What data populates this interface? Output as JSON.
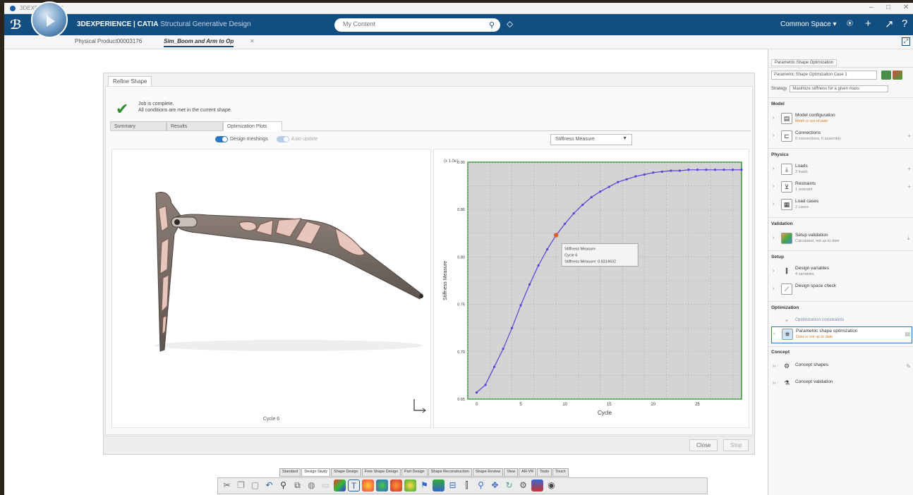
{
  "window": {
    "title": "3DEXPERIENCE",
    "min": "–",
    "max": "□",
    "close": "✕"
  },
  "topbar": {
    "brand_bold": "3DEXPERIENCE | CATIA",
    "brand_sub": "Structural Generative Design",
    "search_placeholder": "My Content",
    "space": "Common Space ▾"
  },
  "tabs": {
    "first": "Physical Product00003176",
    "active": "Sim_Boom and Arm to Op",
    "close": "✕"
  },
  "dialog": {
    "tab": "Refine Shape",
    "status_line1": "Job is complete.",
    "status_line2": "All conditions are met in the current shape.",
    "result_tabs": [
      "Summary",
      "Results",
      "Optimization Plots"
    ],
    "toggle1": "Design meshings",
    "toggle2": "Auto update",
    "select_value": "Stiffness Measure",
    "shape_caption": "Cycle 6",
    "close_btn": "Close",
    "apply_btn": "Stop"
  },
  "chart_data": {
    "type": "line",
    "xlabel": "Cycle",
    "ylabel": "Stiffness Measure",
    "scale_label": "(x 1.0e)",
    "xlim": [
      -1,
      30
    ],
    "ylim": [
      0.65,
      0.9
    ],
    "xticks": [
      0,
      5,
      10,
      15,
      20,
      25
    ],
    "yticks": [
      0.65,
      0.7,
      0.75,
      0.8,
      0.85,
      0.9
    ],
    "ytick_labels": [
      "0.65",
      "0.70",
      "0.75",
      "0.80",
      "0.85",
      "0.90"
    ],
    "x": [
      0,
      1,
      2,
      3,
      4,
      5,
      6,
      7,
      8,
      9,
      10,
      11,
      12,
      13,
      14,
      15,
      16,
      17,
      18,
      19,
      20,
      21,
      22,
      23,
      24,
      25,
      26,
      27,
      28,
      29,
      30
    ],
    "values": [
      0.657,
      0.665,
      0.684,
      0.703,
      0.725,
      0.749,
      0.771,
      0.791,
      0.808,
      0.823,
      0.835,
      0.846,
      0.855,
      0.863,
      0.869,
      0.874,
      0.879,
      0.882,
      0.885,
      0.887,
      0.889,
      0.89,
      0.891,
      0.891,
      0.892,
      0.892,
      0.892,
      0.892,
      0.892,
      0.892,
      0.892
    ],
    "highlight_index": 9,
    "series_color": "#5b3fd6",
    "highlight_color": "#e05a2a",
    "tooltip": [
      "Stiffness Measure",
      "Cycle 6",
      "Stiffness Measure: 0.8314632"
    ],
    "grid": true
  },
  "rpanel": {
    "header": "Parametric Shape Optimization",
    "select": "Parametric Shape Optimization Case 1",
    "strategy_label": "Strategy",
    "strategy_value": "Maximize stiffness for a given mass",
    "sections": {
      "model": "Model",
      "physics": "Physics",
      "validation": "Validation",
      "setup": "Setup",
      "optimization": "Optimization",
      "concept": "Concept"
    },
    "items": {
      "model_config": {
        "label": "Model configuration",
        "sub": "Mesh is out of date"
      },
      "connections": {
        "label": "Connections",
        "sub": "0 connections, 0 assembly"
      },
      "loads": {
        "label": "Loads",
        "sub": "3 loads"
      },
      "restraints": {
        "label": "Restraints",
        "sub": "1 restraint"
      },
      "load_cases": {
        "label": "Load cases",
        "sub": "2 cases"
      },
      "setup_validation": {
        "label": "Setup validation",
        "sub": "Calculated, not up to date"
      },
      "design_variables": {
        "label": "Design variables",
        "sub": "4 variables"
      },
      "design_space": {
        "label": "Design space check",
        "sub": ""
      },
      "opt_constraints": {
        "label": "Optimization constraints",
        "sub": ""
      },
      "pso": {
        "label": "Parametric shape optimization",
        "sub": "Data is not up to date"
      },
      "concept_shapes": {
        "label": "Concept shapes",
        "sub": ""
      },
      "concept_validation": {
        "label": "Concept validation",
        "sub": ""
      }
    }
  },
  "action_tabs": [
    "Standard",
    "Design Study",
    "Shape Design",
    "Free Shape Design",
    "Part Design",
    "Shape Reconstruction",
    "Shape Review",
    "View",
    "AR-VR",
    "Tools",
    "Touch"
  ]
}
